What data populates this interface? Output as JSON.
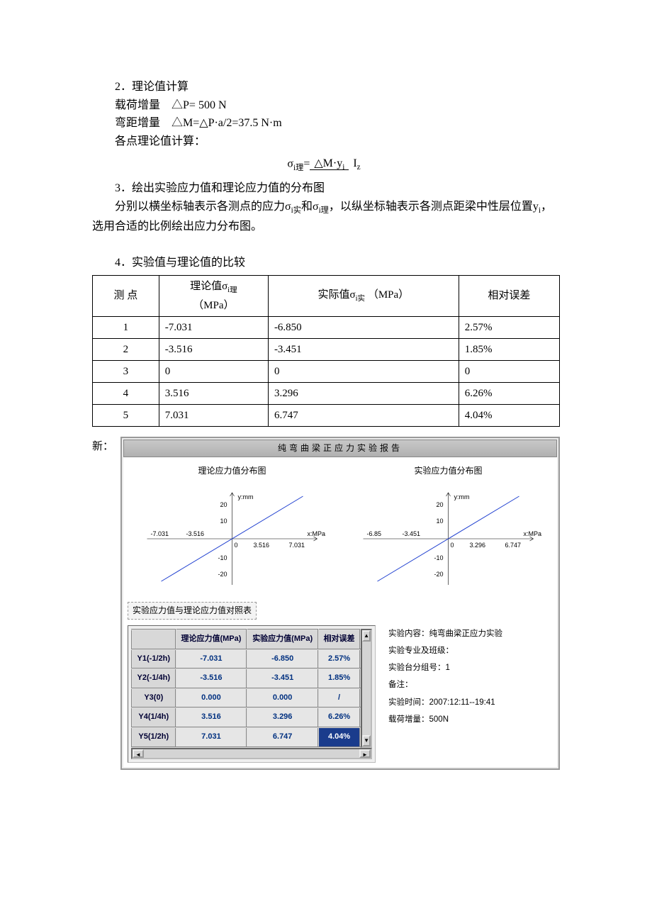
{
  "section2": {
    "heading": "2．理论值计算",
    "line1_label": "载荷增量",
    "line1_expr": "△P= 500    N",
    "line2_label": "弯距增量",
    "line2_expr": "△M=△P·a/2=37.5 N·m",
    "line3": "各点理论值计算：",
    "formula_lhs": "σ",
    "formula_sub_lhs": "i理",
    "formula_eq": "=",
    "formula_num": "△M·y",
    "formula_num_sub": "i",
    "formula_den": "I",
    "formula_den_sub": "z"
  },
  "section3": {
    "heading": "3．绘出实验应力值和理论应力值的分布图",
    "body": "分别以横坐标轴表示各测点的应力σ",
    "sub1": "i实",
    "body2": "和σ",
    "sub2": "i理",
    "body3": "，以纵坐标轴表示各测点距梁中性层位置y",
    "sub3": "i",
    "body4": "，选用合适的比例绘出应力分布图。"
  },
  "section4": {
    "heading": "4．实验值与理论值的比较",
    "headers": {
      "c1": "测    点",
      "c2_line1": "理论值σ",
      "c2_sub": "i理",
      "c2_line2": "（MPa）",
      "c3_pre": "实际值σ",
      "c3_sub": "i实",
      "c3_post": " （MPa）",
      "c4": "相对误差"
    },
    "rows": [
      {
        "pt": "1",
        "theo": "-7.031",
        "act": "-6.850",
        "err": "2.57%"
      },
      {
        "pt": "2",
        "theo": "-3.516",
        "act": "-3.451",
        "err": "1.85%"
      },
      {
        "pt": "3",
        "theo": "0",
        "act": "0",
        "err": "0"
      },
      {
        "pt": "4",
        "theo": "3.516",
        "act": "3.296",
        "err": "6.26%"
      },
      {
        "pt": "5",
        "theo": "7.031",
        "act": "6.747",
        "err": "4.04%"
      }
    ]
  },
  "app": {
    "prefix": "新：",
    "title": "纯弯曲梁正应力实验报告",
    "chart1_title": "理论应力值分布图",
    "chart2_title": "实验应力值分布图",
    "ylabel": "y:mm",
    "xlabel": "x:MPa",
    "table_caption": "实验应力值与理论应力值对照表",
    "inner_headers": {
      "c0": "",
      "c1": "理论应力值(MPa)",
      "c2": "实验应力值(MPa)",
      "c3": "相对误差"
    },
    "inner_rows": [
      {
        "name": "Y1(-1/2h)",
        "theo": "-7.031",
        "act": "-6.850",
        "err": "2.57%"
      },
      {
        "name": "Y2(-1/4h)",
        "theo": "-3.516",
        "act": "-3.451",
        "err": "1.85%"
      },
      {
        "name": "Y3(0)",
        "theo": "0.000",
        "act": "0.000",
        "err": "/"
      },
      {
        "name": "Y4(1/4h)",
        "theo": "3.516",
        "act": "3.296",
        "err": "6.26%"
      },
      {
        "name": "Y5(1/2h)",
        "theo": "7.031",
        "act": "6.747",
        "err": "4.04%"
      }
    ],
    "info": [
      "实验内容：纯弯曲梁正应力实验",
      "实验专业及班级：",
      "实验台分组号：1",
      "备注：",
      "实验时间：2007:12:11--19:41",
      "载荷增量：500N"
    ]
  },
  "chart_data": [
    {
      "type": "line",
      "title": "理论应力值分布图",
      "xlabel": "x:MPa",
      "ylabel": "y:mm",
      "xlim": [
        -7.031,
        7.031
      ],
      "ylim": [
        -20,
        20
      ],
      "x_ticks": [
        -7.031,
        -3.516,
        0,
        3.516,
        7.031
      ],
      "y_ticks": [
        -20,
        -10,
        0,
        10,
        20
      ],
      "series": [
        {
          "name": "理论",
          "x": [
            -7.031,
            -3.516,
            0,
            3.516,
            7.031
          ],
          "y": [
            -20,
            -10,
            0,
            10,
            20
          ]
        }
      ]
    },
    {
      "type": "line",
      "title": "实验应力值分布图",
      "xlabel": "x:MPa",
      "ylabel": "y:mm",
      "xlim": [
        -6.85,
        6.747
      ],
      "ylim": [
        -20,
        20
      ],
      "x_ticks": [
        -6.85,
        -3.451,
        0,
        3.296,
        6.747
      ],
      "y_ticks": [
        -20,
        -10,
        0,
        10,
        20
      ],
      "series": [
        {
          "name": "实验",
          "x": [
            -6.85,
            -3.451,
            0,
            3.296,
            6.747
          ],
          "y": [
            -20,
            -10,
            0,
            10,
            20
          ]
        }
      ]
    }
  ]
}
